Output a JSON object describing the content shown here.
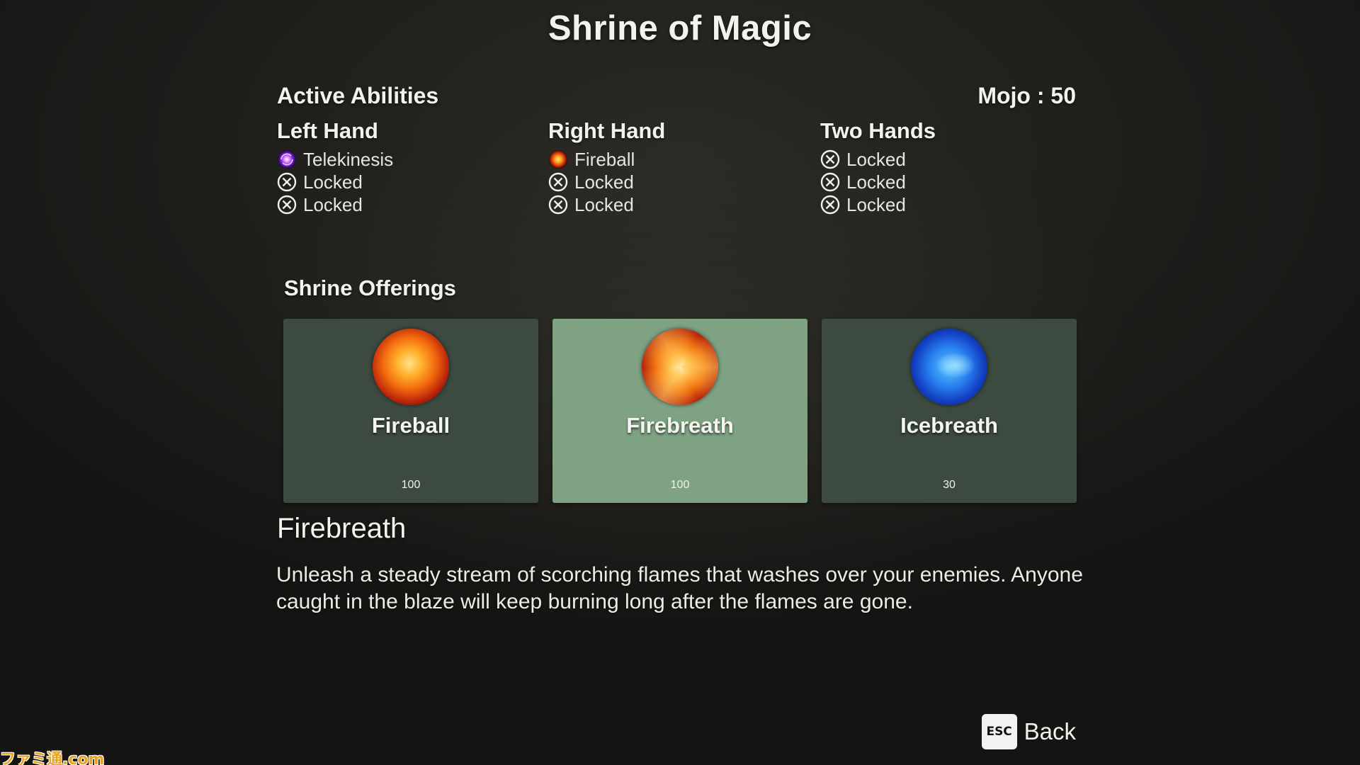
{
  "screen": {
    "title": "Shrine of Magic"
  },
  "active_abilities": {
    "label": "Active Abilities",
    "mojo_text": "Mojo : 50",
    "columns": [
      {
        "title": "Left Hand",
        "slots": [
          {
            "label": "Telekinesis",
            "icon": "telekinesis-icon"
          },
          {
            "label": "Locked",
            "icon": "locked-icon"
          },
          {
            "label": "Locked",
            "icon": "locked-icon"
          }
        ]
      },
      {
        "title": "Right Hand",
        "slots": [
          {
            "label": "Fireball",
            "icon": "fireball-icon"
          },
          {
            "label": "Locked",
            "icon": "locked-icon"
          },
          {
            "label": "Locked",
            "icon": "locked-icon"
          }
        ]
      },
      {
        "title": "Two Hands",
        "slots": [
          {
            "label": "Locked",
            "icon": "locked-icon"
          },
          {
            "label": "Locked",
            "icon": "locked-icon"
          },
          {
            "label": "Locked",
            "icon": "locked-icon"
          }
        ]
      }
    ]
  },
  "offerings": {
    "label": "Shrine Offerings",
    "items": [
      {
        "name": "Fireball",
        "cost": "100",
        "icon": "fireball-orb-icon",
        "selected": false
      },
      {
        "name": "Firebreath",
        "cost": "100",
        "icon": "firebreath-orb-icon",
        "selected": true
      },
      {
        "name": "Icebreath",
        "cost": "30",
        "icon": "icebreath-orb-icon",
        "selected": false
      }
    ]
  },
  "detail": {
    "name": "Firebreath",
    "description": "Unleash a steady stream of scorching flames that washes over your enemies. Anyone caught in the blaze will keep burning long after the flames are gone."
  },
  "footer": {
    "esc_key_label": "ESC",
    "back_label": "Back"
  },
  "watermark": "ファミ通.com",
  "colors": {
    "card_default": "#3c4a40",
    "card_selected": "#7fa283",
    "background": "#1e1d1a"
  }
}
